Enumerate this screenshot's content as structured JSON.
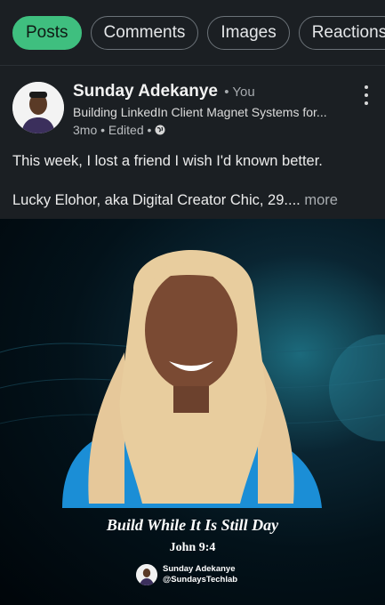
{
  "tabs": [
    {
      "label": "Posts",
      "active": true
    },
    {
      "label": "Comments",
      "active": false
    },
    {
      "label": "Images",
      "active": false
    },
    {
      "label": "Reactions",
      "active": false
    }
  ],
  "post": {
    "author": "Sunday Adekanye",
    "relation": "• You",
    "headline": "Building LinkedIn Client Magnet Systems for...",
    "meta": "3mo • Edited •",
    "paragraph1": "This week, I lost a friend I wish I'd known better.",
    "paragraph2": "Lucky Elohor, aka Digital Creator Chic, 29....",
    "more_label": "more"
  },
  "image": {
    "title": "Build While It Is Still Day",
    "verse": "John 9:4",
    "credit_name": "Sunday Adekanye",
    "credit_handle": "@SundaysTechlab"
  },
  "colors": {
    "active_tab": "#3fbf7f",
    "background": "#1b1f23"
  }
}
